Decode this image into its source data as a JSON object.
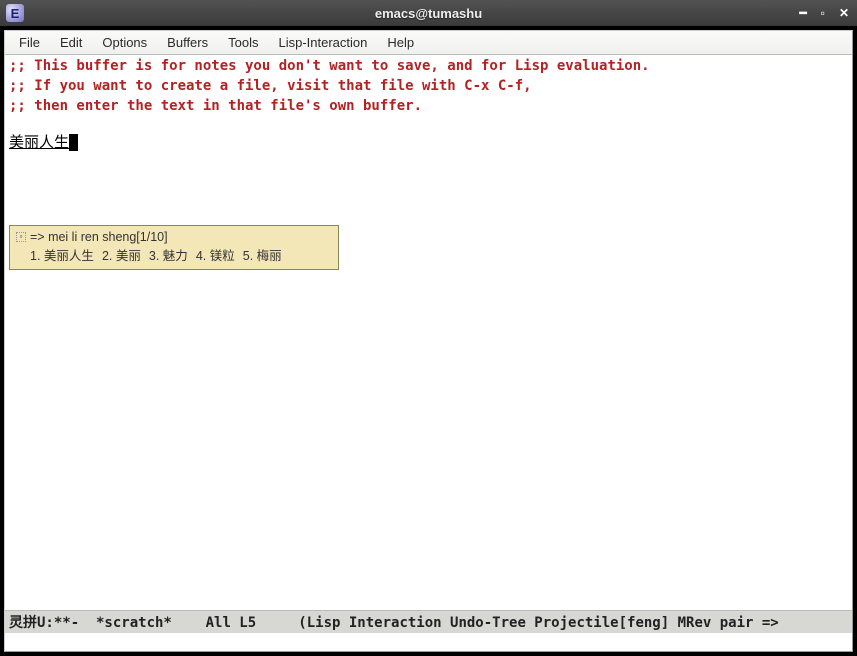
{
  "window": {
    "title": "emacs@tumashu",
    "app_icon_letter": "E"
  },
  "menubar": {
    "items": [
      "File",
      "Edit",
      "Options",
      "Buffers",
      "Tools",
      "Lisp-Interaction",
      "Help"
    ]
  },
  "buffer": {
    "comment_line1": ";; This buffer is for notes you don't want to save, and for Lisp evaluation.",
    "comment_line2": ";; If you want to create a file, visit that file with C-x C-f,",
    "comment_line3": ";; then enter the text in that file's own buffer.",
    "input_text": "美丽人生"
  },
  "ime": {
    "guide": "=> mei li ren sheng[1/10]",
    "candidates": [
      {
        "n": "1.",
        "text": "美丽人生"
      },
      {
        "n": "2.",
        "text": "美丽"
      },
      {
        "n": "3.",
        "text": "魅力"
      },
      {
        "n": "4.",
        "text": "镁粒"
      },
      {
        "n": "5.",
        "text": "梅丽"
      }
    ]
  },
  "modeline": {
    "left": "灵拼U:**- ",
    "buffer_name_outer": " *scratch* ",
    "position": "   All L5    ",
    "modes": " (Lisp Interaction Undo-Tree Projectile[feng] MRev pair =>"
  }
}
